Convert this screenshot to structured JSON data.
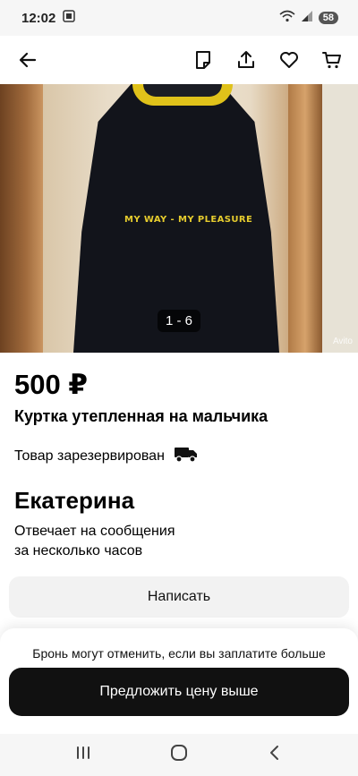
{
  "status": {
    "time": "12:02",
    "battery": "58"
  },
  "gallery": {
    "counter": "1 - 6",
    "coat_text": "MY WAY - MY PLEASURE",
    "watermark": "Avito"
  },
  "listing": {
    "price": "500 ₽",
    "title": "Куртка утепленная на мальчика",
    "reserved_text": "Товар зарезервирован"
  },
  "seller": {
    "name": "Екатерина",
    "response_line1": "Отвечает на сообщения",
    "response_line2": "за несколько часов"
  },
  "actions": {
    "write_label": "Написать",
    "hint": "Бронь могут отменить, если вы заплатите больше",
    "offer_label": "Предложить цену выше"
  },
  "icons": {
    "back": "arrow-left-icon",
    "notes": "note-icon",
    "share": "share-icon",
    "favorite": "heart-icon",
    "cart": "cart-icon",
    "delivery": "truck-icon"
  },
  "colors": {
    "accent": "#111111",
    "button_secondary": "#f2f2f2",
    "hood_yellow": "#e0c21a"
  }
}
